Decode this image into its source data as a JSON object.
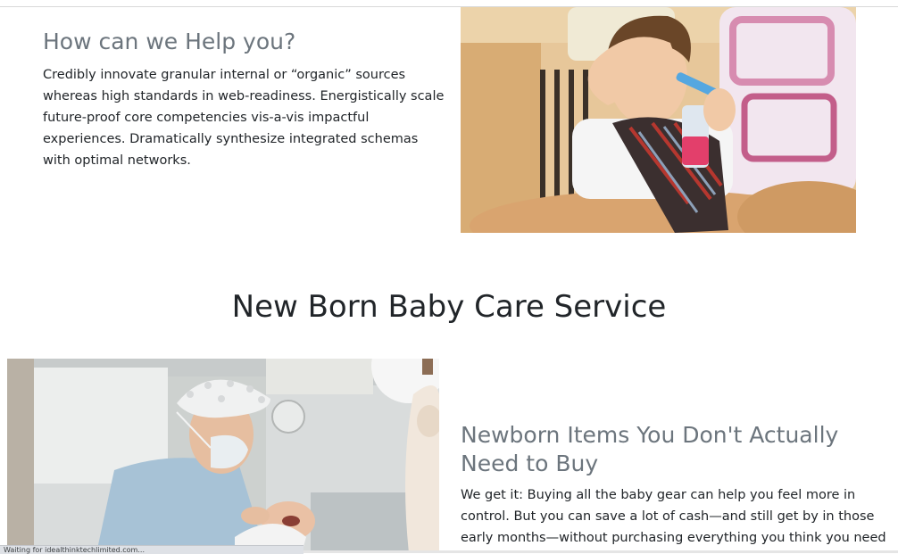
{
  "help": {
    "title": "How can we Help you?",
    "body": "Credibly innovate granular internal or “organic” sources whereas high standards in web-readiness. Energistically scale future-proof core competencies vis-a-vis impactful experiences. Dramatically synthesize integrated schemas with optimal networks."
  },
  "baby_care": {
    "title": "New Born Baby Care Service"
  },
  "newborn": {
    "title": "Newborn Items You Don't Actually Need to Buy",
    "body": "We get it: Buying all the baby gear can help you feel more in control. But you can save a lot of cash—and still get by in those early months—without purchasing everything you think you need"
  },
  "status_bar": {
    "text": "Waiting for idealthinktechlimited.com..."
  },
  "colors": {
    "heading_muted": "#6c757d",
    "text": "#212529",
    "background": "#ffffff"
  }
}
